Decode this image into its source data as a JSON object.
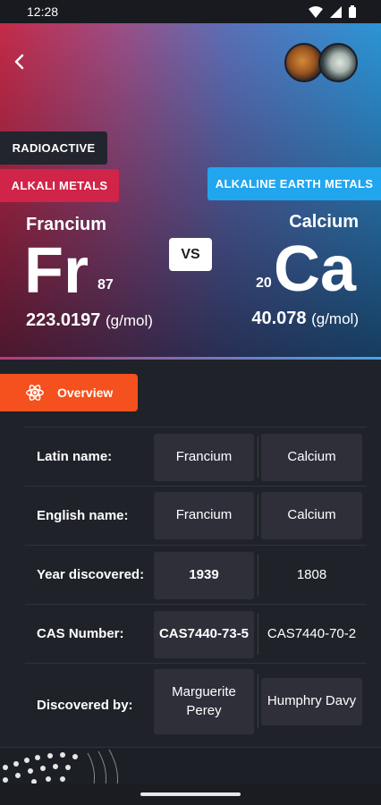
{
  "status": {
    "time": "12:28"
  },
  "tags": {
    "radioactive": "RADIOACTIVE",
    "left_category": "ALKALI METALS",
    "right_category": "ALKALINE EARTH METALS"
  },
  "left": {
    "name": "Francium",
    "symbol": "Fr",
    "number": "87",
    "mass": "223.0197",
    "unit": "(g/mol)"
  },
  "right": {
    "name": "Calcium",
    "symbol": "Ca",
    "number": "20",
    "mass": "40.078",
    "unit": "(g/mol)"
  },
  "vs_label": "VS",
  "overview_label": "Overview",
  "rows": [
    {
      "label": "Latin name:",
      "left": "Francium",
      "right": "Calcium"
    },
    {
      "label": "English name:",
      "left": "Francium",
      "right": "Calcium"
    },
    {
      "label": "Year discovered:",
      "left": "1939",
      "right": "1808"
    },
    {
      "label": "CAS Number:",
      "left": "CAS7440-73-5",
      "right": "CAS7440-70-2"
    },
    {
      "label": "Discovered by:",
      "left": "Marguerite Perey",
      "right": "Humphry Davy"
    }
  ],
  "colors": {
    "alkali": "#d02448",
    "alkaline_earth": "#21a6ee",
    "overview": "#f4511e"
  }
}
